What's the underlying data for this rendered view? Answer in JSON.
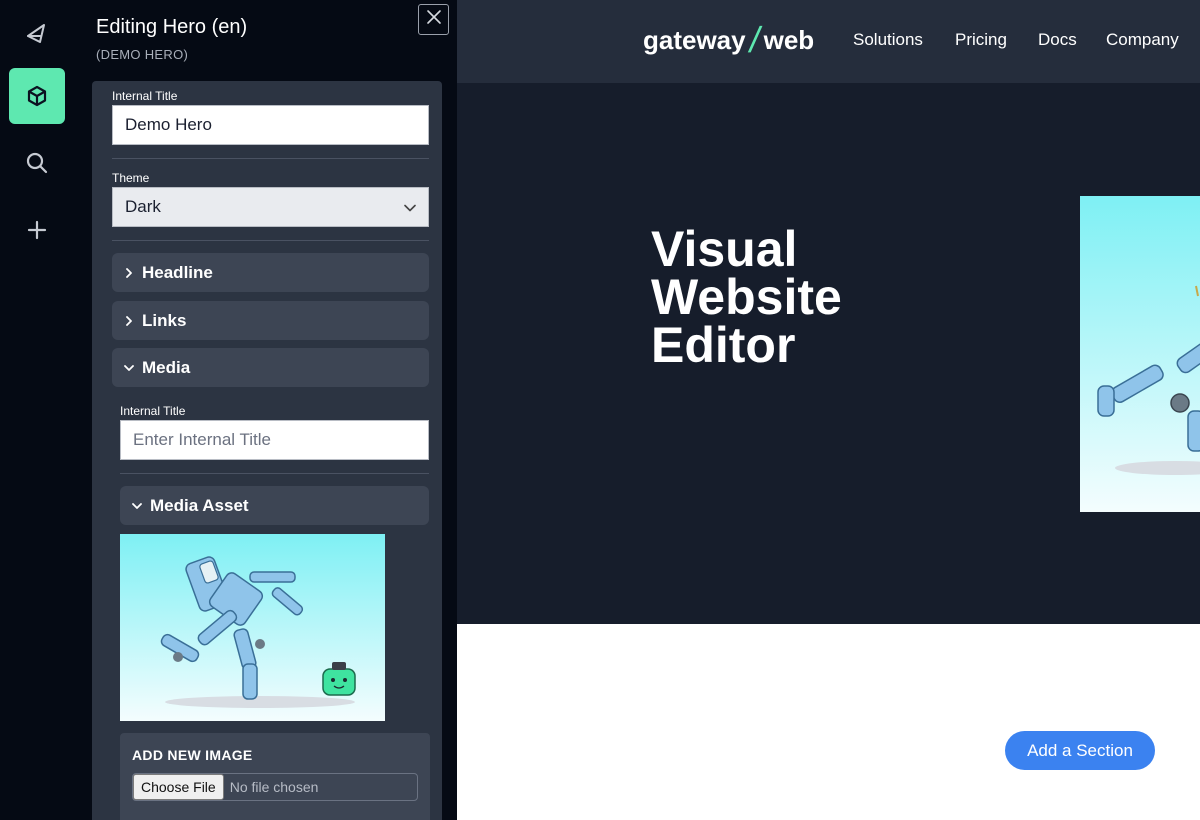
{
  "rail": {
    "items": [
      {
        "icon": "feather-icon"
      },
      {
        "icon": "cube-icon",
        "active": true
      },
      {
        "icon": "search-icon"
      },
      {
        "icon": "plus-icon"
      }
    ]
  },
  "panel": {
    "title": "Editing Hero (en)",
    "subtitle": "(DEMO HERO)",
    "internal_title_label": "Internal Title",
    "internal_title_value": "Demo Hero",
    "theme_label": "Theme",
    "theme_value": "Dark",
    "sections": {
      "headline": "Headline",
      "links": "Links",
      "media": "Media"
    },
    "media": {
      "internal_title_label": "Internal Title",
      "internal_title_placeholder": "Enter Internal Title",
      "asset_label": "Media Asset",
      "add_new_image": "ADD NEW IMAGE",
      "choose_file": "Choose File",
      "no_file": "No file chosen"
    }
  },
  "preview": {
    "logo_left": "gateway",
    "logo_right": "web",
    "nav": [
      "Solutions",
      "Pricing",
      "Docs",
      "Company"
    ],
    "hero_lines": [
      "Visual",
      "Website",
      "Editor"
    ],
    "add_section": "Add a Section"
  },
  "colors": {
    "accent": "#5ee8b0",
    "button_blue": "#3b82f0",
    "panel_bg": "#050a14",
    "form_bg": "#2c3442",
    "hero_bg": "#161d2b"
  }
}
